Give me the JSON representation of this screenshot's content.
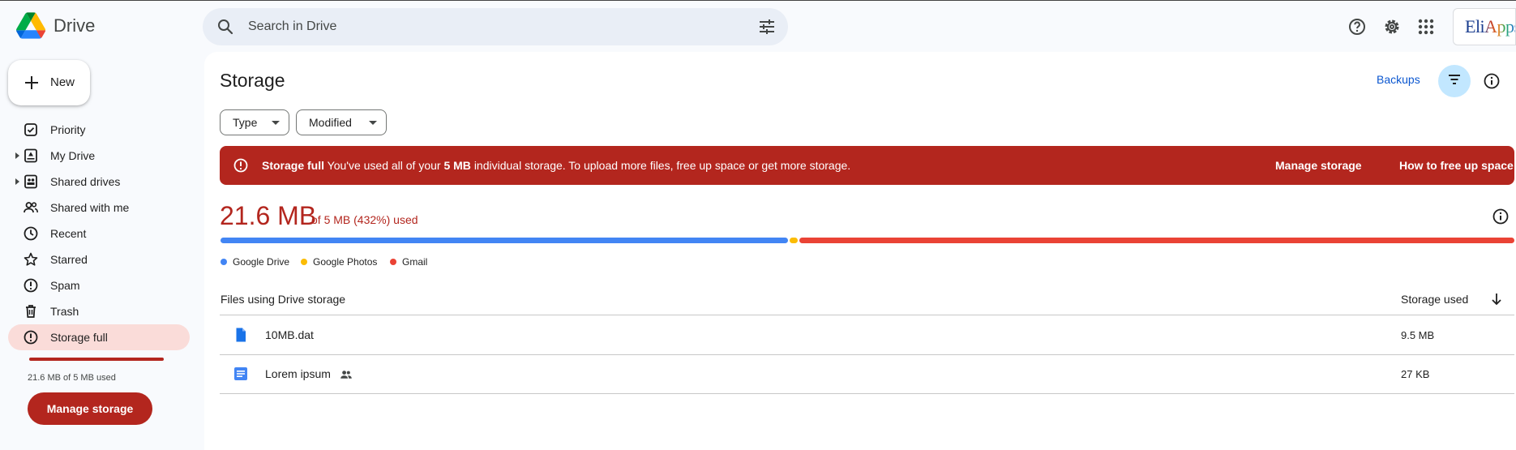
{
  "header": {
    "app_name": "Drive",
    "search_placeholder": "Search in Drive",
    "account_label": "EliApps"
  },
  "sidebar": {
    "new_label": "New",
    "items": [
      {
        "label": "Priority",
        "icon": "priority-icon"
      },
      {
        "label": "My Drive",
        "icon": "my-drive-icon",
        "expandable": true
      },
      {
        "label": "Shared drives",
        "icon": "shared-drives-icon",
        "expandable": true
      },
      {
        "label": "Shared with me",
        "icon": "shared-with-me-icon"
      },
      {
        "label": "Recent",
        "icon": "recent-icon"
      },
      {
        "label": "Starred",
        "icon": "star-icon"
      },
      {
        "label": "Spam",
        "icon": "spam-icon"
      },
      {
        "label": "Trash",
        "icon": "trash-icon"
      },
      {
        "label": "Storage full",
        "icon": "storage-alert-icon",
        "active": true
      }
    ],
    "quota_text": "21.6 MB of 5 MB used",
    "manage_storage_label": "Manage storage"
  },
  "main": {
    "title": "Storage",
    "backups_label": "Backups",
    "filters": [
      "Type",
      "Modified"
    ],
    "banner": {
      "bold_title": "Storage full",
      "text_before": "You've used all of your",
      "text_bold": "5 MB",
      "text_after": "individual storage. To upload more files, free up space or get more storage.",
      "manage_label": "Manage storage",
      "free_up_label": "How to free up space"
    },
    "usage": {
      "used": "21.6 MB",
      "detail": "of 5 MB (432%) used"
    },
    "legend": [
      {
        "label": "Google Drive",
        "color": "#4285f4"
      },
      {
        "label": "Google Photos",
        "color": "#fbbc04"
      },
      {
        "label": "Gmail",
        "color": "#ea4335"
      }
    ],
    "files_header": {
      "left": "Files using Drive storage",
      "right": "Storage used"
    },
    "files": [
      {
        "name": "10MB.dat",
        "size": "9.5 MB",
        "shared": false
      },
      {
        "name": "Lorem ipsum",
        "size": "27 KB",
        "shared": true
      }
    ]
  },
  "colors": {
    "alert_red": "#b3261e",
    "link_blue": "#0b57d0",
    "drive_blue": "#4285f4",
    "photos_yellow": "#fbbc04",
    "gmail_red": "#ea4335"
  }
}
